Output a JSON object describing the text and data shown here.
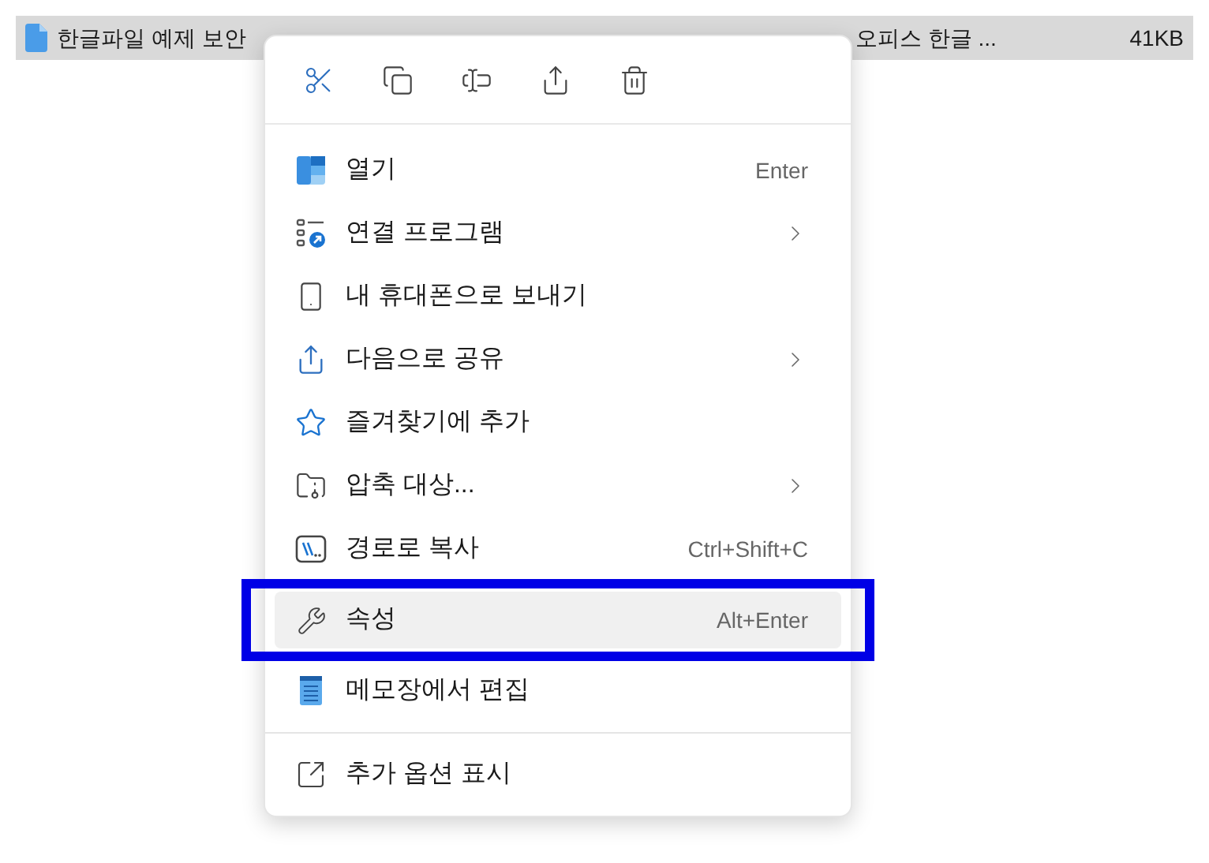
{
  "file_row": {
    "name": "한글파일 예제 보안",
    "type": "오피스 한글 ...",
    "size": "41KB",
    "selected": true
  },
  "context_menu": {
    "items": [
      {
        "label": "열기",
        "shortcut": "Enter",
        "submenu": false,
        "selected": false,
        "marked": false
      },
      {
        "label": "연결 프로그램",
        "submenu": true,
        "selected": false,
        "marked": false
      },
      {
        "label": "내 휴대폰으로 보내기",
        "submenu": false,
        "selected": false,
        "marked": false
      },
      {
        "label": "다음으로 공유",
        "submenu": true,
        "selected": false,
        "marked": false
      },
      {
        "label": "즐겨찾기에 추가",
        "submenu": false,
        "selected": false,
        "marked": false
      },
      {
        "label": "압축 대상...",
        "submenu": true,
        "selected": false,
        "marked": false
      },
      {
        "label": "경로로 복사",
        "shortcut": "Ctrl+Shift+C",
        "submenu": false,
        "selected": false,
        "marked": false
      },
      {
        "label": "속성",
        "shortcut": "Alt+Enter",
        "submenu": false,
        "selected": true,
        "marked": true
      },
      {
        "label": "메모장에서 편집",
        "submenu": false,
        "selected": false,
        "marked": false
      }
    ],
    "footer_items": [
      {
        "label": "추가 옵션 표시"
      }
    ]
  }
}
